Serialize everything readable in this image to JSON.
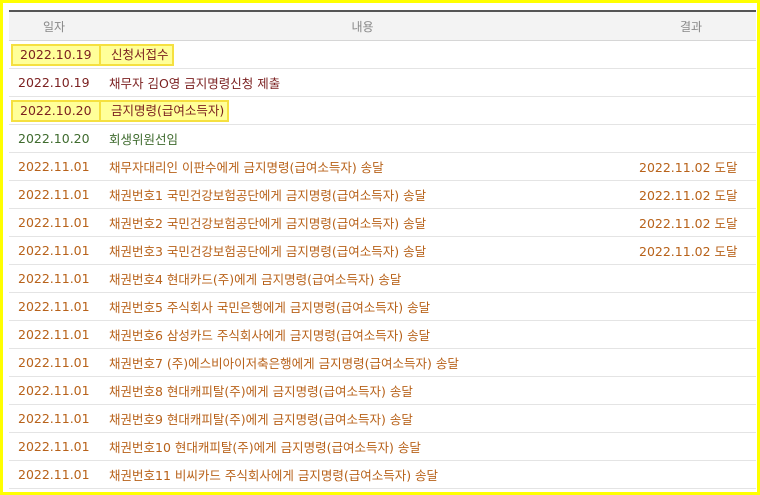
{
  "table": {
    "headers": [
      "일자",
      "내용",
      "결과"
    ],
    "colors": {
      "header_text": "#888888",
      "dark_red": "#7a1f1f",
      "green": "#3f6b2e",
      "orange": "#b8621a",
      "highlight_bg": "#ffff99",
      "highlight_border": "#f5e040"
    },
    "rows": [
      {
        "date": "2022.10.19",
        "content": "신청서접수",
        "result": "",
        "tone": "dark",
        "highlight": true
      },
      {
        "date": "2022.10.19",
        "content": "채무자 김O영 금지명령신청 제출",
        "result": "",
        "tone": "dark",
        "highlight": false
      },
      {
        "date": "2022.10.20",
        "content": "금지명령(급여소득자)",
        "result": "",
        "tone": "dark",
        "highlight": true
      },
      {
        "date": "2022.10.20",
        "content": "회생위원선임",
        "result": "",
        "tone": "green",
        "highlight": false
      },
      {
        "date": "2022.11.01",
        "content": "채무자대리인 이판수에게 금지명령(급여소득자) 송달",
        "result": "2022.11.02 도달",
        "tone": "orange",
        "highlight": false
      },
      {
        "date": "2022.11.01",
        "content": "채권번호1 국민건강보험공단에게 금지명령(급여소득자) 송달",
        "result": "2022.11.02 도달",
        "tone": "orange",
        "highlight": false
      },
      {
        "date": "2022.11.01",
        "content": "채권번호2 국민건강보험공단에게 금지명령(급여소득자) 송달",
        "result": "2022.11.02 도달",
        "tone": "orange",
        "highlight": false
      },
      {
        "date": "2022.11.01",
        "content": "채권번호3 국민건강보험공단에게 금지명령(급여소득자) 송달",
        "result": "2022.11.02 도달",
        "tone": "orange",
        "highlight": false
      },
      {
        "date": "2022.11.01",
        "content": "채권번호4 현대카드(주)에게 금지명령(급여소득자) 송달",
        "result": "",
        "tone": "orange",
        "highlight": false
      },
      {
        "date": "2022.11.01",
        "content": "채권번호5 주식회사 국민은행에게 금지명령(급여소득자) 송달",
        "result": "",
        "tone": "orange",
        "highlight": false
      },
      {
        "date": "2022.11.01",
        "content": "채권번호6 삼성카드 주식회사에게 금지명령(급여소득자) 송달",
        "result": "",
        "tone": "orange",
        "highlight": false
      },
      {
        "date": "2022.11.01",
        "content": "채권번호7 (주)에스비아이저축은행에게 금지명령(급여소득자) 송달",
        "result": "",
        "tone": "orange",
        "highlight": false
      },
      {
        "date": "2022.11.01",
        "content": "채권번호8 현대캐피탈(주)에게 금지명령(급여소득자) 송달",
        "result": "",
        "tone": "orange",
        "highlight": false
      },
      {
        "date": "2022.11.01",
        "content": "채권번호9 현대캐피탈(주)에게 금지명령(급여소득자) 송달",
        "result": "",
        "tone": "orange",
        "highlight": false
      },
      {
        "date": "2022.11.01",
        "content": "채권번호10 현대캐피탈(주)에게 금지명령(급여소득자) 송달",
        "result": "",
        "tone": "orange",
        "highlight": false
      },
      {
        "date": "2022.11.01",
        "content": "채권번호11 비씨카드 주식회사에게 금지명령(급여소득자) 송달",
        "result": "",
        "tone": "orange",
        "highlight": false
      }
    ]
  }
}
